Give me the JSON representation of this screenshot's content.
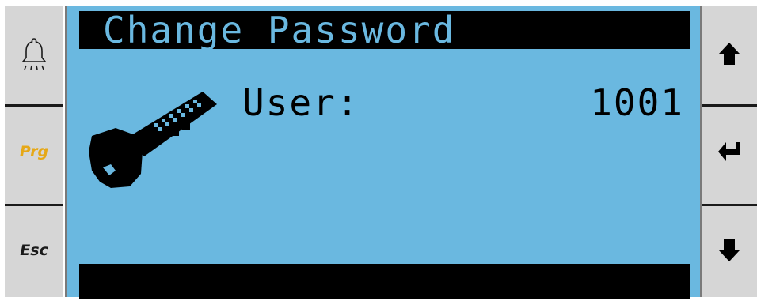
{
  "screen": {
    "title": "Change Password",
    "user_label": "User:",
    "user_value": "1001",
    "background_color": "#6ab8e0"
  },
  "left_buttons": {
    "alarm_icon": "bell-icon",
    "prg_label": "Prg",
    "esc_label": "Esc",
    "prg_color": "#e6a817"
  },
  "right_buttons": {
    "up_icon": "arrow-up-icon",
    "enter_icon": "enter-icon",
    "down_icon": "arrow-down-icon"
  },
  "icons": {
    "key": "key-icon"
  }
}
